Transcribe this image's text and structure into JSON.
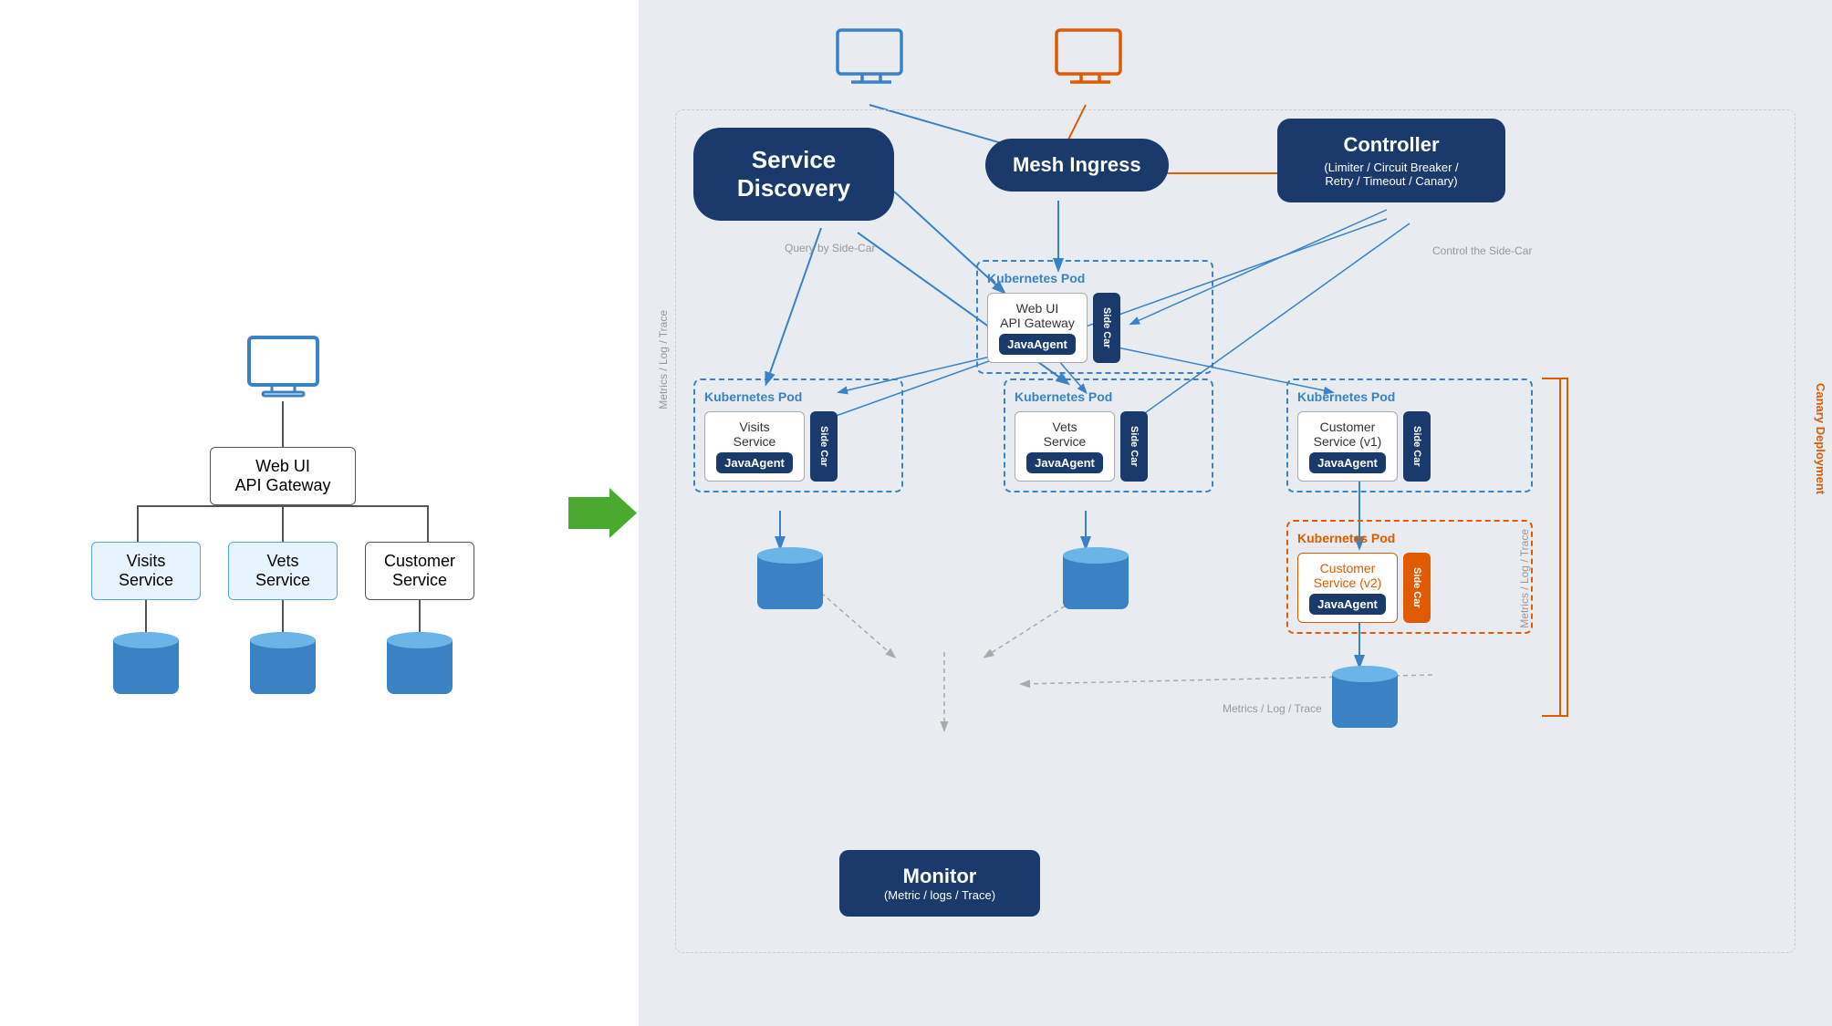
{
  "left": {
    "monitor_label": "Monitor",
    "api_gateway_label": "Web UI\nAPI Gateway",
    "visits_service": "Visits\nService",
    "vets_service": "Vets\nService",
    "customer_service": "Customer\nService"
  },
  "right": {
    "service_discovery": "Service\nDiscovery",
    "mesh_ingress": "Mesh Ingress",
    "controller": "Controller",
    "controller_sub": "(Limiter / Circuit Breaker /\nRetry / Timeout / Canary)",
    "control_sidecar": "Control the Side-Car",
    "query_sidecar": "Query by Side-Car",
    "metrics_log_trace": "Metrics / Log / Trace",
    "pod1_label": "Kubernetes Pod",
    "pod2_label": "Kubernetes Pod",
    "pod3_label": "Kubernetes Pod",
    "pod4_label": "Kubernetes Pod",
    "visits_service": "Visits\nService",
    "vets_service": "Vets\nService",
    "customer_service_v1": "Customer\nService (v1)",
    "customer_service_v2": "Customer\nService (v2)",
    "web_ui_api_gateway": "Web UI\nAPI Gateway",
    "javaagent": "JavaAgent",
    "side_car": "Side Car",
    "monitor_label": "Monitor",
    "monitor_sub": "(Metric / logs / Trace)",
    "canary_deployment": "Canary Deployment"
  }
}
